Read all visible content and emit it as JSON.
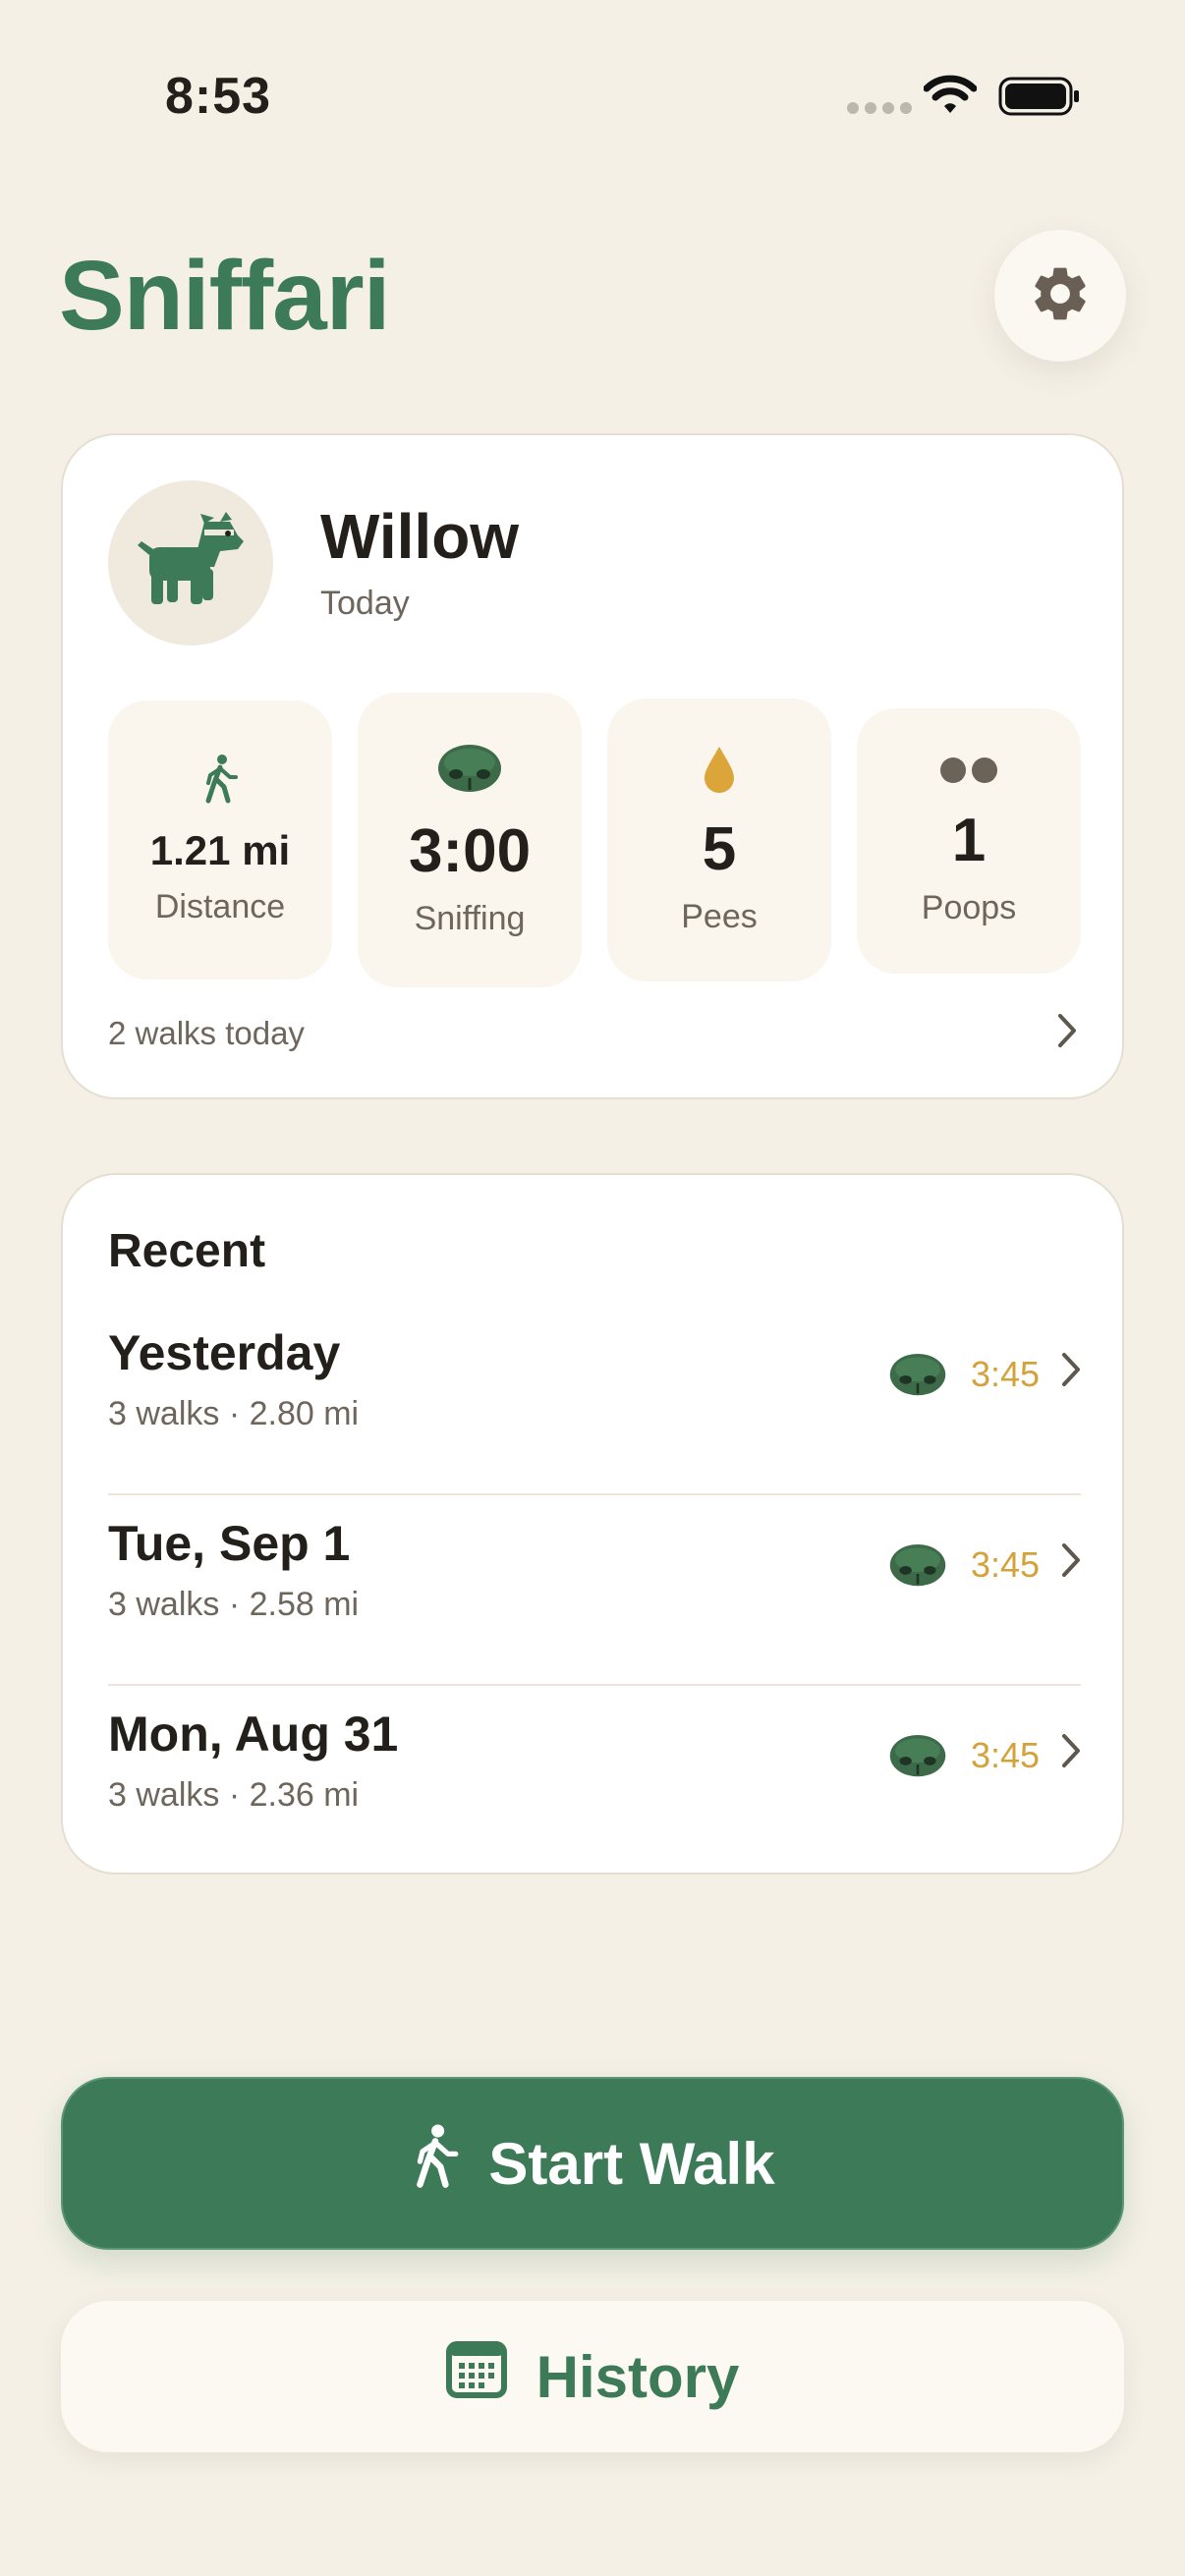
{
  "status_bar": {
    "time": "8:53"
  },
  "header": {
    "title": "Sniffari"
  },
  "today": {
    "dog_name": "Willow",
    "subtitle": "Today",
    "stats": [
      {
        "value": "1.21 mi",
        "label": "Distance",
        "icon": "walking-icon"
      },
      {
        "value": "3:00",
        "label": "Sniffing",
        "icon": "nose-icon"
      },
      {
        "value": "5",
        "label": "Pees",
        "icon": "drop-icon"
      },
      {
        "value": "1",
        "label": "Poops",
        "icon": "poop-dots-icon"
      }
    ],
    "walks_summary": "2 walks today"
  },
  "recent": {
    "title": "Recent",
    "items": [
      {
        "date": "Yesterday",
        "meta": "3 walks · 2.80 mi",
        "sniff_time": "3:45"
      },
      {
        "date": "Tue, Sep 1",
        "meta": "3 walks · 2.58 mi",
        "sniff_time": "3:45"
      },
      {
        "date": "Mon, Aug 31",
        "meta": "3 walks · 2.36 mi",
        "sniff_time": "3:45"
      }
    ]
  },
  "actions": {
    "start_walk": "Start Walk",
    "history": "History"
  },
  "colors": {
    "brand_green": "#3d7b58",
    "background": "#f4f0e6",
    "sniff_gold": "#d4a23a",
    "pee_gold": "#dba53a"
  }
}
